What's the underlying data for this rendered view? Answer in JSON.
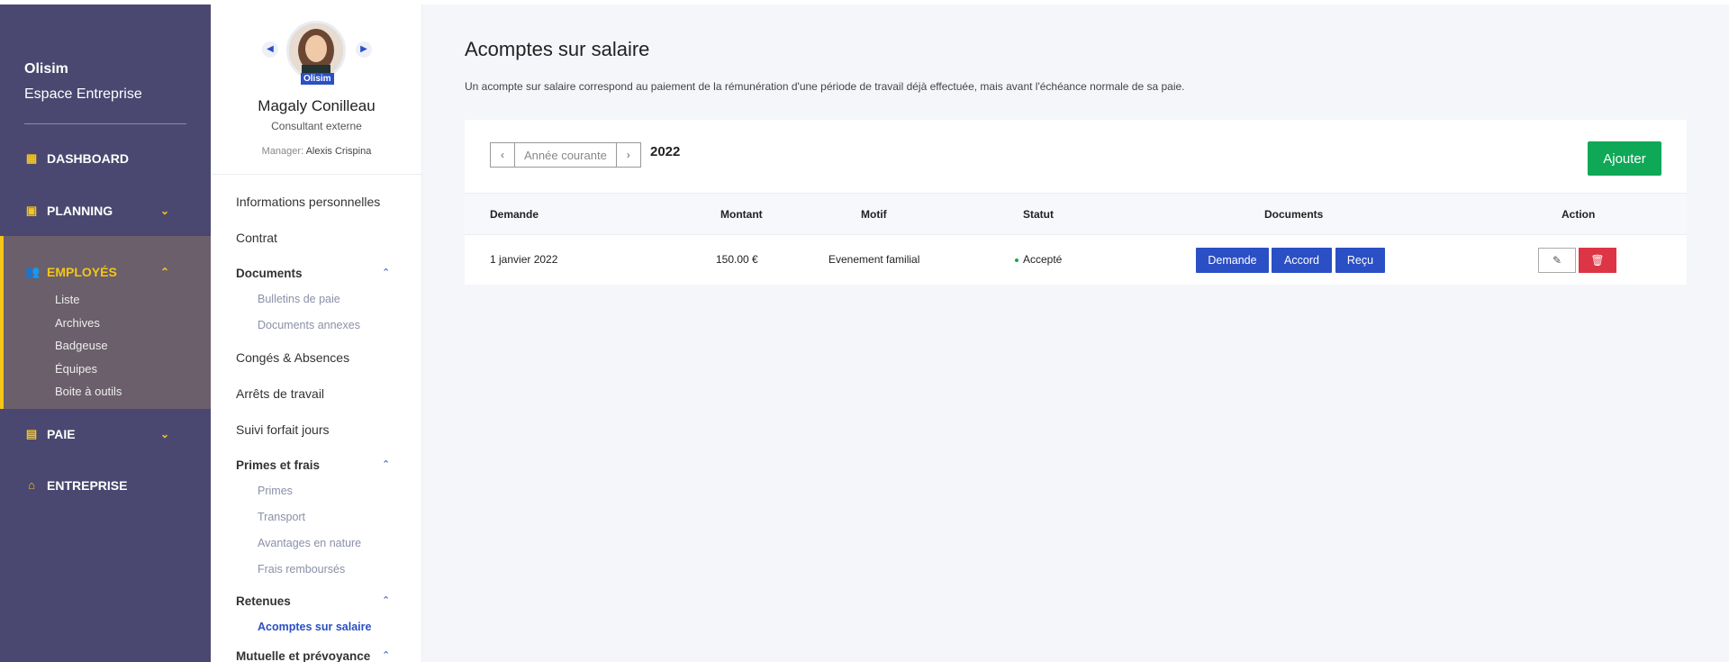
{
  "brand": {
    "name": "Olisim",
    "subtitle": "Espace Entreprise"
  },
  "nav": {
    "dashboard": "DASHBOARD",
    "planning": "PLANNING",
    "employes": "EMPLOYÉS",
    "employes_sub": [
      "Liste",
      "Archives",
      "Badgeuse",
      "Équipes",
      "Boite à outils"
    ],
    "paie": "PAIE",
    "entreprise": "ENTREPRISE"
  },
  "employee": {
    "badge": "Olisim",
    "name": "Magaly Conilleau",
    "role": "Consultant externe",
    "manager_label": "Manager:",
    "manager_name": "Alexis Crispina"
  },
  "menu": {
    "infos": "Informations personnelles",
    "contrat": "Contrat",
    "documents": "Documents",
    "bulletins": "Bulletins de paie",
    "annexes": "Documents annexes",
    "conges": "Congés & Absences",
    "arrets": "Arrêts de travail",
    "forfait": "Suivi forfait jours",
    "primes_frais": "Primes et frais",
    "primes": "Primes",
    "transport": "Transport",
    "avantages": "Avantages en nature",
    "frais": "Frais remboursés",
    "retenues": "Retenues",
    "acomptes": "Acomptes sur salaire",
    "mutuelle": "Mutuelle et prévoyance"
  },
  "page": {
    "title": "Acomptes sur salaire",
    "description": "Un acompte sur salaire correspond au paiement de la rémunération d'une période de travail déjà effectuée, mais avant l'échéance normale de sa paie.",
    "year_label": "Année courante",
    "year": "2022",
    "add_label": "Ajouter"
  },
  "table": {
    "headers": [
      "Demande",
      "Montant",
      "Motif",
      "Statut",
      "Documents",
      "Action"
    ],
    "rows": [
      {
        "demande": "1 janvier 2022",
        "montant": "150.00 €",
        "motif": "Evenement familial",
        "statut": "Accepté",
        "docs": [
          "Demande",
          "Accord",
          "Reçu"
        ]
      }
    ]
  },
  "colors": {
    "sidebar": "#4a4870",
    "accent": "#f5c518",
    "primary": "#2b4fc4",
    "success": "#0fa856",
    "danger": "#dc3545"
  },
  "icons": [
    "dashboard-icon",
    "calendar-icon",
    "users-icon",
    "file-icon",
    "home-icon",
    "pencil-icon",
    "trash-icon"
  ]
}
